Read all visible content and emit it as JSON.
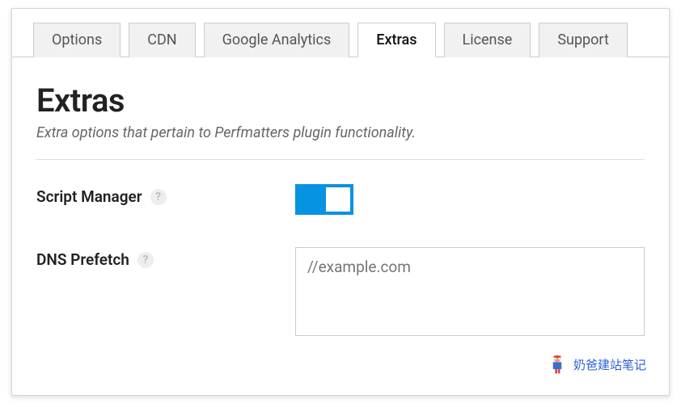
{
  "tabs": {
    "options": "Options",
    "cdn": "CDN",
    "analytics": "Google Analytics",
    "extras": "Extras",
    "license": "License",
    "support": "Support"
  },
  "page": {
    "title": "Extras",
    "description": "Extra options that pertain to Perfmatters plugin functionality."
  },
  "fields": {
    "script_manager": {
      "label": "Script Manager",
      "help": "?",
      "enabled": true
    },
    "dns_prefetch": {
      "label": "DNS Prefetch",
      "help": "?",
      "placeholder": "//example.com",
      "value": ""
    }
  },
  "watermark": {
    "text": "奶爸建站笔记"
  }
}
